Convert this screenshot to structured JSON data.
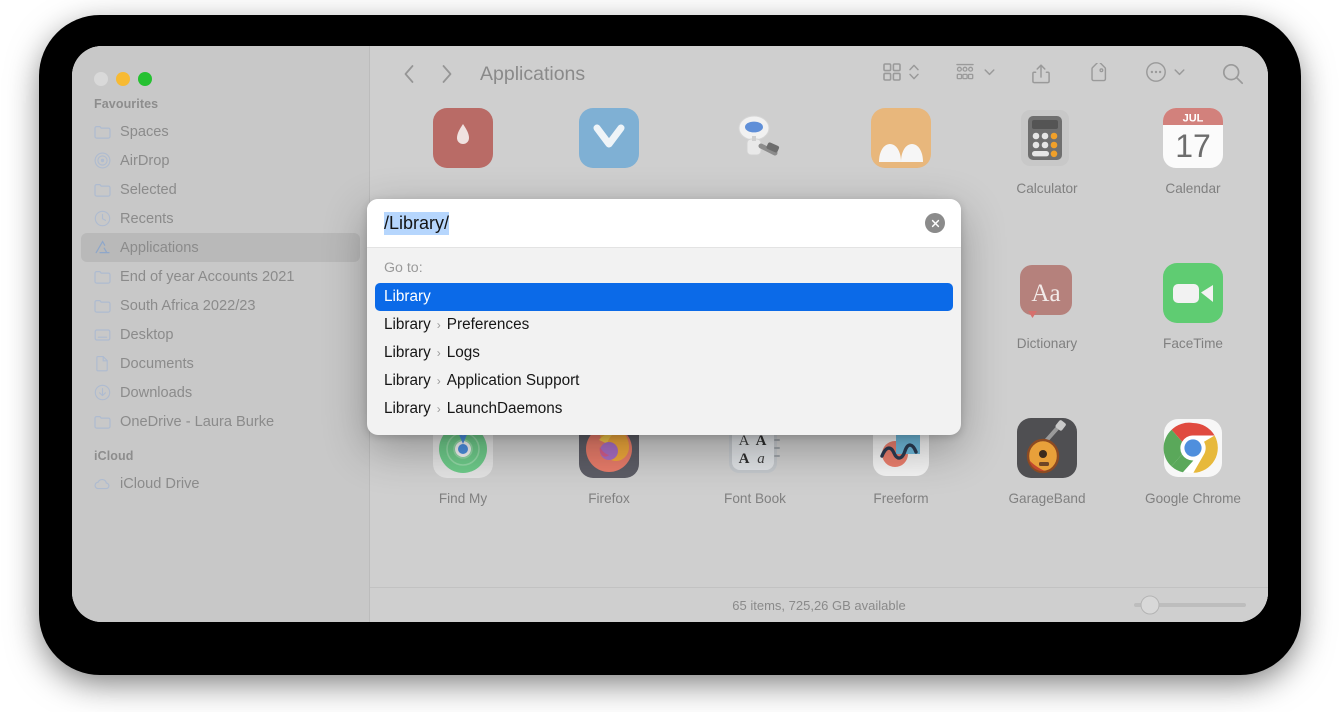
{
  "window": {
    "title": "Applications",
    "traffic_lights": [
      "close",
      "minimize",
      "maximize"
    ]
  },
  "toolbar": {
    "back_icon": "chevron-left-icon",
    "forward_icon": "chevron-right-icon",
    "view_icon": "icon-view-grid-icon",
    "view_stepper_icon": "chevron-up-down-icon",
    "group_icon": "group-by-icon",
    "group_chevron_icon": "chevron-down-icon",
    "share_icon": "share-icon",
    "tag_icon": "tag-icon",
    "more_icon": "ellipsis-circle-icon",
    "more_chevron_icon": "chevron-down-icon",
    "search_icon": "search-icon"
  },
  "sidebar": {
    "sections": [
      {
        "title": "Favourites",
        "items": [
          {
            "label": "Spaces",
            "icon": "folder-icon",
            "selected": false
          },
          {
            "label": "AirDrop",
            "icon": "airdrop-icon",
            "selected": false
          },
          {
            "label": "Selected",
            "icon": "folder-icon",
            "selected": false
          },
          {
            "label": "Recents",
            "icon": "clock-icon",
            "selected": false
          },
          {
            "label": "Applications",
            "icon": "applications-icon",
            "selected": true
          },
          {
            "label": "End of year Accounts 2021",
            "icon": "folder-icon",
            "selected": false
          },
          {
            "label": "South Africa 2022/23",
            "icon": "folder-icon",
            "selected": false
          },
          {
            "label": "Desktop",
            "icon": "desktop-icon",
            "selected": false
          },
          {
            "label": "Documents",
            "icon": "document-icon",
            "selected": false
          },
          {
            "label": "Downloads",
            "icon": "downloads-icon",
            "selected": false
          },
          {
            "label": "OneDrive - Laura Burke",
            "icon": "folder-icon",
            "selected": false
          }
        ]
      },
      {
        "title": "iCloud",
        "items": [
          {
            "label": "iCloud Drive",
            "icon": "cloud-icon",
            "selected": false
          }
        ]
      }
    ]
  },
  "main": {
    "rows": [
      {
        "items": [
          {
            "label": "",
            "icon": "app-red-icon"
          },
          {
            "label": "",
            "icon": "app-blue-icon"
          },
          {
            "label": "",
            "icon": "automator-icon"
          },
          {
            "label": "",
            "icon": "books-icon"
          },
          {
            "label": "Calculator",
            "icon": "calculator-icon"
          },
          {
            "label": "Calendar",
            "icon": "calendar-icon"
          }
        ]
      },
      {
        "items": [
          {
            "label": "",
            "icon": "app-hidden-icon"
          },
          {
            "label": "",
            "icon": "app-hidden-icon"
          },
          {
            "label": "",
            "icon": "app-hidden-icon"
          },
          {
            "label": "",
            "icon": "app-hidden-icon"
          },
          {
            "label": "Dictionary",
            "icon": "dictionary-icon"
          },
          {
            "label": "FaceTime",
            "icon": "facetime-icon"
          }
        ]
      },
      {
        "items": [
          {
            "label": "Find My",
            "icon": "findmy-icon"
          },
          {
            "label": "Firefox",
            "icon": "firefox-icon"
          },
          {
            "label": "Font Book",
            "icon": "fontbook-icon"
          },
          {
            "label": "Freeform",
            "icon": "freeform-icon"
          },
          {
            "label": "GarageBand",
            "icon": "garageband-icon"
          },
          {
            "label": "Google Chrome",
            "icon": "chrome-icon"
          }
        ]
      }
    ]
  },
  "status": {
    "text": "65 items, 725,26 GB available",
    "zoom_slider_value": 14
  },
  "goto_dialog": {
    "input_value": "/Library/",
    "input_selected": true,
    "clear_icon": "clear-circle-x-icon",
    "list_label": "Go to:",
    "suggestions": [
      {
        "root": "Library",
        "child": "",
        "selected": true
      },
      {
        "root": "Library",
        "child": "Preferences",
        "selected": false
      },
      {
        "root": "Library",
        "child": "Logs",
        "selected": false
      },
      {
        "root": "Library",
        "child": "Application Support",
        "selected": false
      },
      {
        "root": "Library",
        "child": "LaunchDaemons",
        "selected": false
      }
    ],
    "separator": "›"
  },
  "colors": {
    "accent": "#0b6ae8",
    "selection_highlight": "#b6d6fd",
    "window_bg": "#c7c7c7",
    "content_bg": "#cfcfcf"
  }
}
